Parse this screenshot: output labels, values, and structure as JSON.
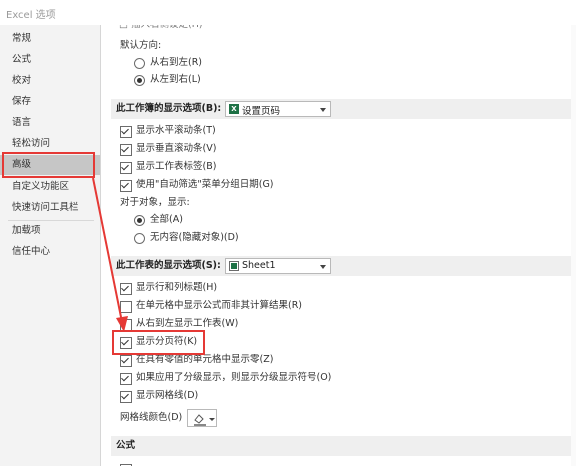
{
  "window": {
    "title": "Excel 选项"
  },
  "sidebar": {
    "items": [
      {
        "label": "常规"
      },
      {
        "label": "公式"
      },
      {
        "label": "校对"
      },
      {
        "label": "保存"
      },
      {
        "label": "语言"
      },
      {
        "label": "轻松访问"
      },
      {
        "label": "高级"
      },
      {
        "label": "自定义功能区"
      },
      {
        "label": "快速访问工具栏"
      },
      {
        "label": "加载项"
      },
      {
        "label": "信任中心"
      }
    ],
    "selected": "高级"
  },
  "main": {
    "top_cut_text": "□ 插入右侧设定(H)",
    "direction": {
      "label": "默认方向:",
      "options": [
        {
          "label": "从右到左(R)",
          "selected": false
        },
        {
          "label": "从左到右(L)",
          "selected": true
        }
      ]
    },
    "workbook_section": {
      "title": "此工作簿的显示选项(B):",
      "dropdown_value": "设置页码",
      "options": [
        {
          "label": "显示水平滚动条(T)",
          "checked": true
        },
        {
          "label": "显示垂直滚动条(V)",
          "checked": true
        },
        {
          "label": "显示工作表标签(B)",
          "checked": true
        },
        {
          "label": "使用\"自动筛选\"菜单分组日期(G)",
          "checked": true
        }
      ],
      "objects_label": "对于对象，显示:",
      "objects_options": [
        {
          "label": "全部(A)",
          "selected": true
        },
        {
          "label": "无内容(隐藏对象)(D)",
          "selected": false
        }
      ]
    },
    "worksheet_section": {
      "title": "此工作表的显示选项(S):",
      "dropdown_value": "Sheet1",
      "options": [
        {
          "label": "显示行和列标题(H)",
          "checked": true
        },
        {
          "label": "在单元格中显示公式而非其计算结果(R)",
          "checked": false
        },
        {
          "label": "从右到左显示工作表(W)",
          "checked": false
        },
        {
          "label": "显示分页符(K)",
          "checked": true
        },
        {
          "label": "在具有零值的单元格中显示零(Z)",
          "checked": true
        },
        {
          "label": "如果应用了分级显示，则显示分级显示符号(O)",
          "checked": true
        },
        {
          "label": "显示网格线(D)",
          "checked": true
        }
      ],
      "gridline_color_label": "网格线颜色(D)"
    },
    "formula_section": {
      "title": "公式"
    }
  },
  "colors": {
    "annotation": "#e53935",
    "selected_sidebar": "#c6c6c6",
    "excel_green": "#1e7145"
  }
}
